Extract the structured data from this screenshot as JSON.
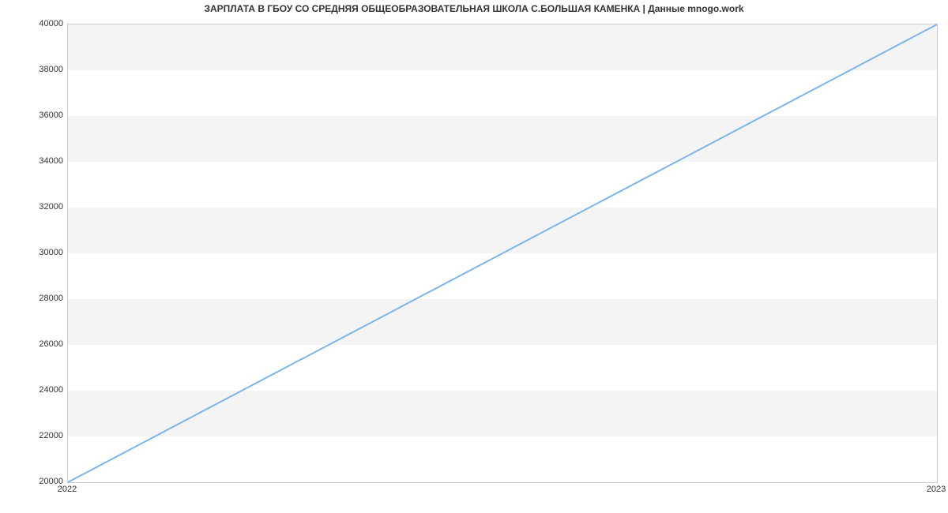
{
  "chart_data": {
    "type": "line",
    "title": "ЗАРПЛАТА В ГБОУ СО СРЕДНЯЯ ОБЩЕОБРАЗОВАТЕЛЬНАЯ ШКОЛА С.БОЛЬШАЯ КАМЕНКА | Данные mnogo.work",
    "x": [
      2022,
      2023
    ],
    "y": [
      20000,
      40000
    ],
    "xticks": [
      2022,
      2023
    ],
    "yticks": [
      20000,
      22000,
      24000,
      26000,
      28000,
      30000,
      32000,
      34000,
      36000,
      38000,
      40000
    ],
    "ylim": [
      20000,
      40000
    ],
    "xlim": [
      2022,
      2023
    ],
    "xlabel": "",
    "ylabel": "",
    "line_color": "#7cb5ec"
  }
}
